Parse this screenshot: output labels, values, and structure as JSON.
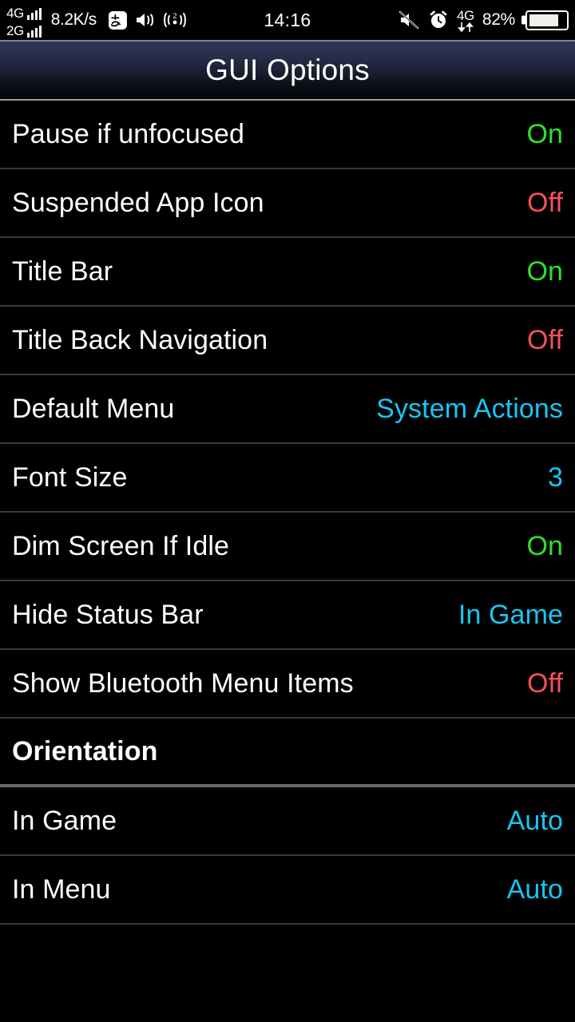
{
  "status_bar": {
    "sim1_network": "4G",
    "sim1_signal_bars": 4,
    "sim2_network": "2G",
    "sim2_signal_bars": 4,
    "network_speed": "8.2K/s",
    "icons": [
      "alipay-icon",
      "speaker-icon",
      "hotspot-icon"
    ],
    "hotspot_count": "2",
    "time": "14:16",
    "right_icons": [
      "mute-icon",
      "alarm-clock-icon",
      "mobile-data-4g-icon"
    ],
    "data_network": "4G",
    "battery_percent": "82%",
    "battery_level": 82
  },
  "title_bar": {
    "title": "GUI Options"
  },
  "settings": {
    "rows": [
      {
        "label": "Pause if unfocused",
        "value": "On",
        "state": "on",
        "type": "toggle"
      },
      {
        "label": "Suspended App Icon",
        "value": "Off",
        "state": "off",
        "type": "toggle"
      },
      {
        "label": "Title Bar",
        "value": "On",
        "state": "on",
        "type": "toggle"
      },
      {
        "label": "Title Back Navigation",
        "value": "Off",
        "state": "off",
        "type": "toggle"
      },
      {
        "label": "Default Menu",
        "value": "System Actions",
        "state": "choice",
        "type": "select"
      },
      {
        "label": "Font Size",
        "value": "3",
        "state": "choice",
        "type": "select"
      },
      {
        "label": "Dim Screen If Idle",
        "value": "On",
        "state": "on",
        "type": "toggle"
      },
      {
        "label": "Hide Status Bar",
        "value": "In Game",
        "state": "choice",
        "type": "select"
      },
      {
        "label": "Show Bluetooth Menu Items",
        "value": "Off",
        "state": "off",
        "type": "toggle"
      },
      {
        "label": "Orientation",
        "value": "",
        "state": "none",
        "type": "header"
      },
      {
        "label": "In Game",
        "value": "Auto",
        "state": "choice",
        "type": "select"
      },
      {
        "label": "In Menu",
        "value": "Auto",
        "state": "choice",
        "type": "select"
      }
    ]
  },
  "colors": {
    "on": "#2ee02e",
    "off": "#f4505a",
    "choice": "#16c6f2",
    "label": "#ffffff",
    "background": "#000000",
    "divider": "#3a3a3a",
    "header_divider": "#6a6a6a",
    "titlebar_top": "#2e3552"
  }
}
